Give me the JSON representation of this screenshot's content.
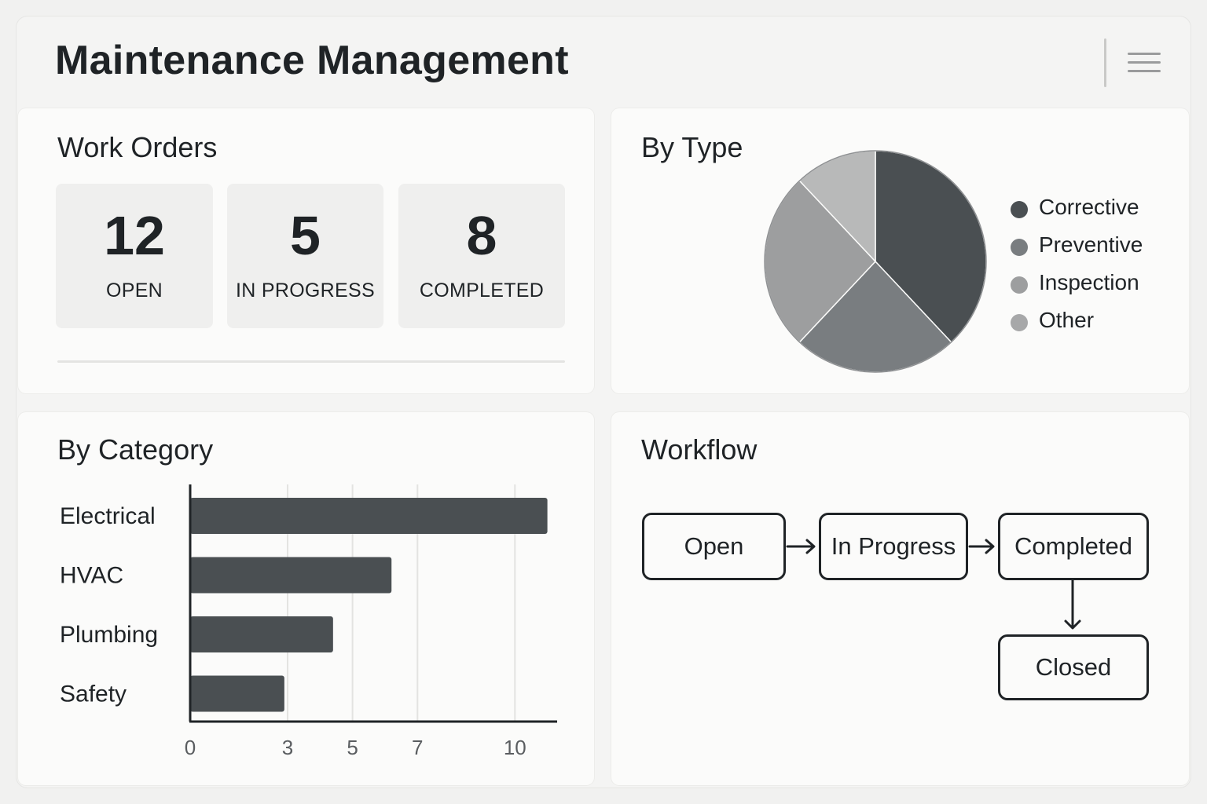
{
  "header": {
    "title": "Maintenance Management",
    "menu_icon": "hamburger-menu-icon"
  },
  "work_orders": {
    "title": "Work Orders",
    "stats": [
      {
        "value": "12",
        "label": "OPEN"
      },
      {
        "value": "5",
        "label": "IN PROGRESS"
      },
      {
        "value": "8",
        "label": "COMPLETED"
      }
    ]
  },
  "by_type": {
    "title": "By Type"
  },
  "by_category": {
    "title": "By Category"
  },
  "workflow": {
    "title": "Workflow",
    "steps": [
      "Open",
      "In Progress",
      "Completed",
      "Closed"
    ]
  },
  "chart_data": [
    {
      "type": "pie",
      "title": "By Type",
      "series": [
        {
          "name": "Corrective",
          "value": 38,
          "color": "#4a4f52"
        },
        {
          "name": "Preventive",
          "value": 24,
          "color": "#797d80"
        },
        {
          "name": "Inspection",
          "value": 26,
          "color": "#9d9e9f"
        },
        {
          "name": "Other",
          "value": 12,
          "color": "#b8b9b9"
        }
      ],
      "legend_position": "right"
    },
    {
      "type": "bar",
      "orientation": "horizontal",
      "title": "By Category",
      "categories": [
        "Electrical",
        "HVAC",
        "Plumbing",
        "Safety"
      ],
      "values": [
        11,
        6.2,
        4.4,
        2.9
      ],
      "xticks": [
        0,
        3,
        5,
        7,
        10
      ],
      "xlim": [
        0,
        11.3
      ],
      "grid": true,
      "bar_color": "#4a4f52"
    }
  ]
}
